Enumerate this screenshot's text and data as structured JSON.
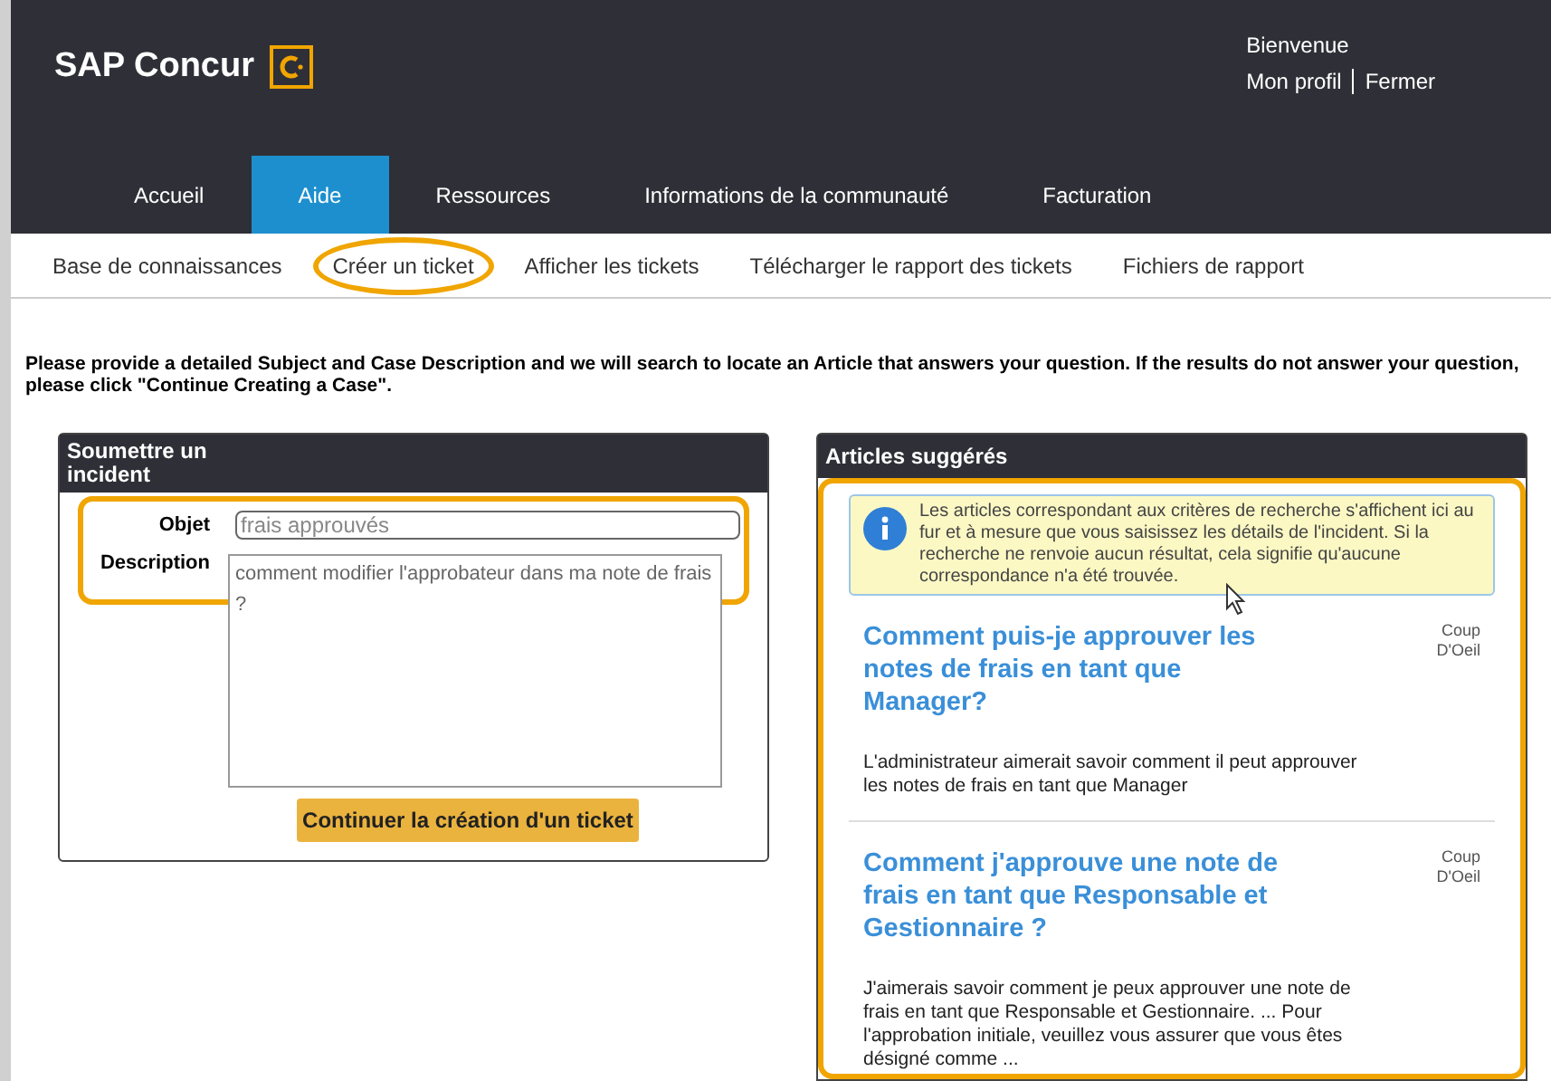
{
  "header": {
    "logo": "SAP Concur",
    "greeting": "Bienvenue",
    "links": [
      "Mon profil",
      "Fermer"
    ]
  },
  "nav": [
    {
      "label": "Accueil",
      "selected": false
    },
    {
      "label": "Aide",
      "selected": true
    },
    {
      "label": "Ressources",
      "selected": false
    },
    {
      "label": "Informations de la communauté",
      "selected": false
    },
    {
      "label": "Facturation",
      "selected": false
    }
  ],
  "subnav": [
    {
      "label": "Base de connaissances",
      "highlighted": false
    },
    {
      "label": "Créer un ticket",
      "highlighted": true
    },
    {
      "label": "Afficher les tickets",
      "highlighted": false
    },
    {
      "label": "Télécharger le rapport des tickets",
      "highlighted": false
    },
    {
      "label": "Fichiers de rapport",
      "highlighted": false
    }
  ],
  "instructions": "Please provide a detailed Subject and Case Description and we will search to locate an Article that answers your question. If the results do not answer your question, please click \"Continue Creating a Case\".",
  "form": {
    "title": "Soumettre un incident",
    "subject_label": "Objet",
    "subject_value": "frais approuvés",
    "description_label": "Description",
    "description_value": "comment modifier l'approbateur dans ma note de frais ?",
    "button": "Continuer la création d'un ticket"
  },
  "articles": {
    "title": "Articles suggérés",
    "info": "Les articles correspondant aux critères de recherche s'affichent ici au fur et à mesure que vous saisissez les détails de l'incident. Si la recherche ne renvoie aucun résultat, cela signifie qu'aucune correspondance n'a été trouvée.",
    "items": [
      {
        "title": "Comment puis-je approuver les notes de frais en tant que Manager?",
        "preview": "Coup D'Oeil",
        "summary": "L'administrateur aimerait savoir comment il peut approuver les notes de frais en tant que Manager"
      },
      {
        "title": "Comment j'approuve une note de frais en tant que Responsable et Gestionnaire ?",
        "preview": "Coup D'Oeil",
        "summary": "J'aimerais savoir comment je peux approuver une note de frais en tant que Responsable et Gestionnaire. ... Pour l'approbation initiale, veuillez vous assurer que vous êtes désigné comme ..."
      }
    ]
  }
}
